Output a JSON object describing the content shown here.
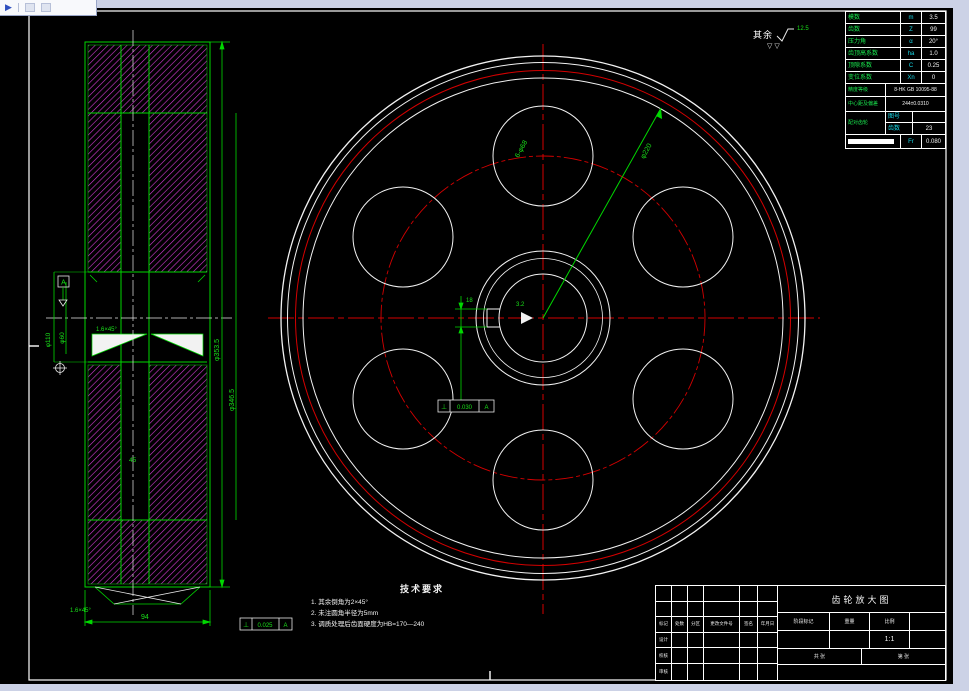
{
  "app": {
    "toolbar_icon": "▶"
  },
  "roughness_note": {
    "prefix": "其余",
    "value": "12.5",
    "marks": "▽▽"
  },
  "param_table": {
    "rows": [
      {
        "label": "模数",
        "symbol": "m",
        "value": "3.5"
      },
      {
        "label": "齿数",
        "symbol": "Z",
        "value": "99"
      },
      {
        "label": "压力角",
        "symbol": "α",
        "value": "20°"
      },
      {
        "label": "齿顶高系数",
        "symbol": "ha",
        "value": "1.0"
      },
      {
        "label": "顶隙系数",
        "symbol": "C",
        "value": "0.25"
      },
      {
        "label": "变位系数",
        "symbol": "Xn",
        "value": "0"
      }
    ],
    "accuracy": {
      "label": "精度等级",
      "value": "8-HK GB 10095-88"
    },
    "center_dist": {
      "label": "中心距及偏差",
      "value": "244±0.0310"
    },
    "mate": {
      "label": "配对齿轮",
      "row1_key": "图号",
      "row1_val": "",
      "row2_key": "齿数",
      "row2_val": "23"
    },
    "runout": {
      "symbol": "Fr",
      "value": "0.080"
    }
  },
  "tech_req": {
    "title": "技术要求",
    "items": [
      "1. 其余倒角为2×45°",
      "2. 未注圆角半径为5mm",
      "3. 调质处理后齿面硬度为HB=170—240"
    ]
  },
  "left_view": {
    "dia_tip": "φ353.5",
    "dia_pitch": "φ346.5",
    "dia_hub": "φ110",
    "dia_bore": "φ60",
    "width_45": "45",
    "width_94": "94",
    "chamfer_mid": "1.6×45°",
    "chamfer_bottom": "1.6×45°",
    "datum": "A",
    "tol_sym": "⊥",
    "tol_val": "0.025",
    "tol_ref": "A"
  },
  "front_view": {
    "holes_label": "6-φ68",
    "bolt_circle_label": "φ220",
    "keyway_width": "18",
    "roughness": "3.2",
    "tol_sym": "⊥",
    "tol_val": "0.030",
    "tol_ref": "A"
  },
  "title_block": {
    "name": "齿轮放大图",
    "header_cols": [
      "标记",
      "处数",
      "分区",
      "更改文件号",
      "签名",
      "年月日"
    ],
    "left_rows": [
      "设计",
      "校核",
      "审核"
    ],
    "stage_label": "阶段标记",
    "weight_label": "重量",
    "scale_label": "比例",
    "scale_value": "1:1",
    "sheet_total": "共 张",
    "sheet_no": "第 张"
  }
}
